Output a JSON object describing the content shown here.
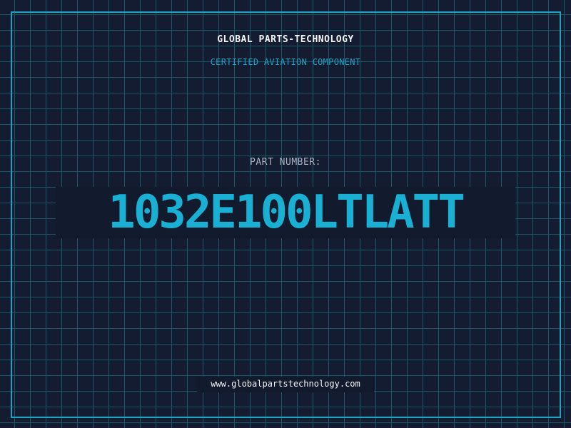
{
  "header": {
    "company": "GLOBAL PARTS-TECHNOLOGY",
    "tagline": "CERTIFIED AVIATION COMPONENT"
  },
  "part": {
    "label": "PART NUMBER:",
    "number": "1032E100LTLATT"
  },
  "footer": {
    "url": "www.globalpartstechnology.com"
  },
  "colors": {
    "background": "#121a2e",
    "accent": "#1ba3c4",
    "text": "#f2f4f7",
    "muted": "#aab2c0"
  }
}
